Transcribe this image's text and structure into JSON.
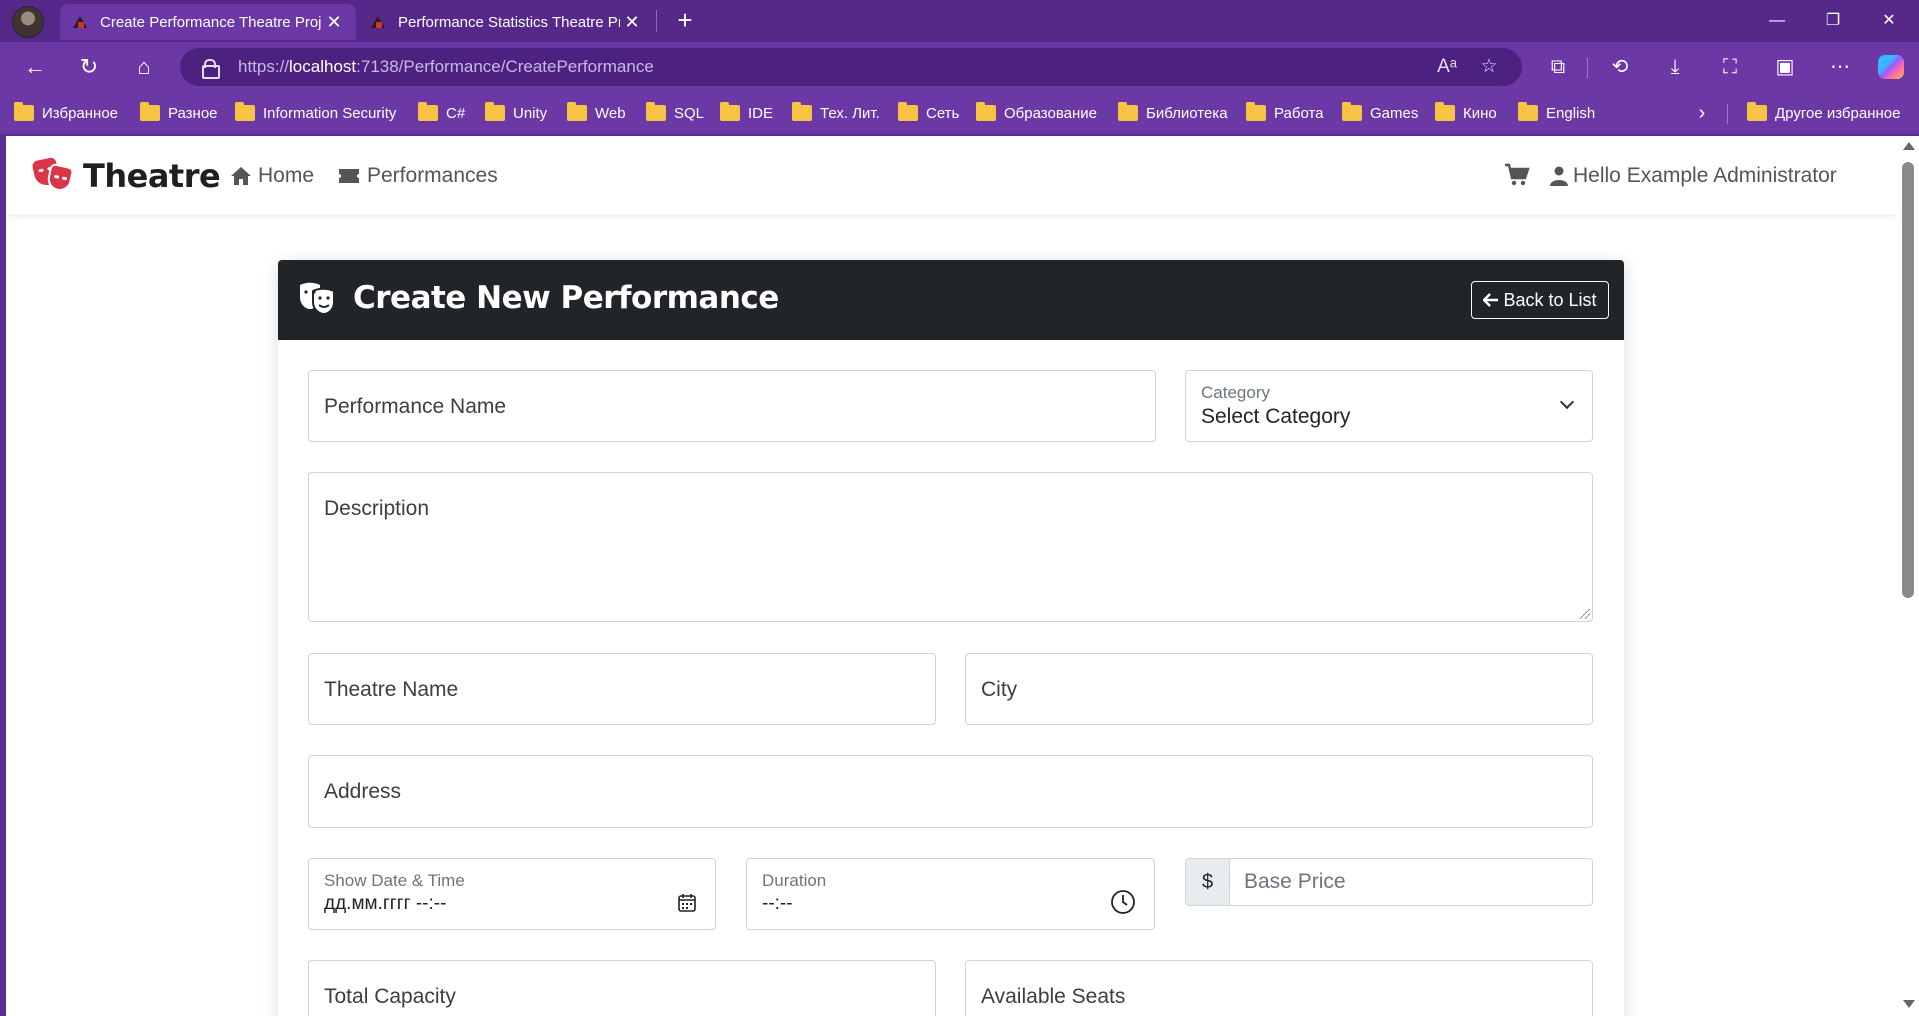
{
  "browser": {
    "tabs": [
      {
        "title": "Create Performance Theatre Proje",
        "active": true
      },
      {
        "title": "Performance Statistics Theatre Pro",
        "active": false
      }
    ],
    "url": {
      "scheme": "https://",
      "host": "localhost",
      "rest": ":7138/Performance/CreatePerformance"
    },
    "bookmarks": [
      "Избранное",
      "Разное",
      "Information Security",
      "C#",
      "Unity",
      "Web",
      "SQL",
      "IDE",
      "Тех. Лит.",
      "Сеть",
      "Образование",
      "Библиотека",
      "Работа",
      "Games",
      "Кино",
      "English"
    ],
    "other_bookmarks": "Другое избранное"
  },
  "site": {
    "brand": "Theatre",
    "nav": {
      "home": "Home",
      "performances": "Performances"
    },
    "user": "Hello Example Administrator"
  },
  "form": {
    "title": "Create New Performance",
    "back_label": "Back to List",
    "name_placeholder": "Performance Name",
    "category_label": "Category",
    "category_value": "Select Category",
    "description_placeholder": "Description",
    "theatre_placeholder": "Theatre Name",
    "city_placeholder": "City",
    "address_placeholder": "Address",
    "show_date_label": "Show Date & Time",
    "show_date_value": "дд.мм.гггг --:--",
    "duration_label": "Duration",
    "duration_value": "--:--",
    "currency_symbol": "$",
    "price_placeholder": "Base Price",
    "capacity_placeholder": "Total Capacity",
    "seats_placeholder": "Available Seats"
  },
  "colors": {
    "browser_purple": "#6b38a6",
    "header_dark": "#212529",
    "brand_red": "#dc3545",
    "folder_yellow": "#f6c343"
  },
  "icons": [
    "profile-avatar",
    "theatre-favicon",
    "close-icon",
    "plus-icon",
    "back-icon",
    "refresh-icon",
    "home-icon",
    "lock-icon",
    "read-aloud-icon",
    "star-icon",
    "extensions-icon",
    "history-icon",
    "download-icon",
    "screenshot-icon",
    "collections-icon",
    "more-icon",
    "copilot-icon",
    "folder-icon",
    "chevron-right-icon",
    "masks-icon",
    "ticket-icon",
    "cart-icon",
    "user-icon",
    "arrow-left-icon",
    "calendar-icon",
    "clock-icon",
    "chevron-down-icon"
  ]
}
